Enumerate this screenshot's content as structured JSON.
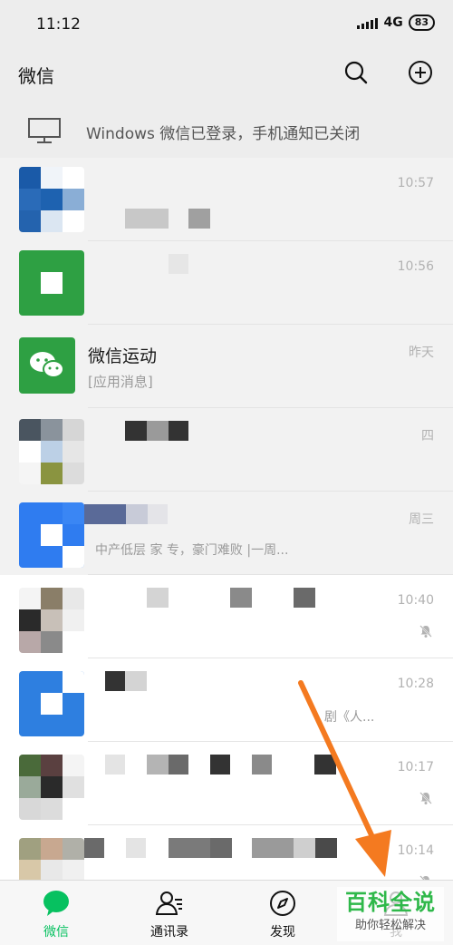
{
  "status_bar": {
    "time": "11:12",
    "network": "4G",
    "battery": "83"
  },
  "header": {
    "title": "微信",
    "search_icon": "search-icon",
    "add_icon": "plus-circle-icon"
  },
  "notice": {
    "icon": "desktop-monitor-icon",
    "text": "Windows 微信已登录，手机通知已关闭"
  },
  "chats": [
    {
      "time": "10:57",
      "title": "",
      "subtitle": ""
    },
    {
      "time": "10:56",
      "title": "",
      "subtitle": ""
    },
    {
      "time": "昨天",
      "title": "微信运动",
      "subtitle": "[应用消息]"
    },
    {
      "time": "四",
      "title": "",
      "subtitle": ""
    },
    {
      "time": "周三",
      "title": "",
      "subtitle": "中产低层 家         专，豪门难败 |一周..."
    },
    {
      "time": "10:40",
      "title": "",
      "subtitle": "",
      "muted": true
    },
    {
      "time": "10:28",
      "title": "",
      "subtitle": "剧《人..."
    },
    {
      "time": "10:17",
      "title": "",
      "subtitle": "",
      "muted": true
    },
    {
      "time": "10:14",
      "title": "",
      "subtitle": "",
      "muted": true
    }
  ],
  "bottom_nav": [
    {
      "label": "微信",
      "icon": "chat-bubble-icon",
      "active": true
    },
    {
      "label": "通讯录",
      "icon": "contacts-icon",
      "active": false
    },
    {
      "label": "发现",
      "icon": "compass-icon",
      "active": false
    },
    {
      "label": "我",
      "icon": "person-icon",
      "active": false
    }
  ],
  "watermark": {
    "title": "百科全说",
    "subtitle": "助你轻松解决"
  },
  "colors": {
    "accent": "#07c160",
    "annotation_arrow": "#f47a20",
    "background": "#ededed"
  }
}
